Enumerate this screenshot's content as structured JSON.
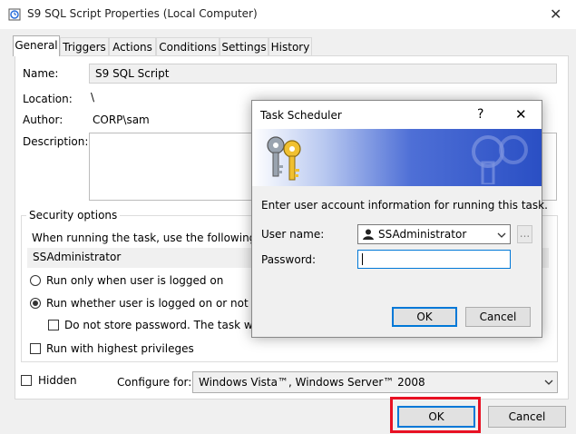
{
  "window": {
    "title": "S9 SQL Script Properties (Local Computer)",
    "close_glyph": "✕"
  },
  "tabs": [
    {
      "label": "General"
    },
    {
      "label": "Triggers"
    },
    {
      "label": "Actions"
    },
    {
      "label": "Conditions"
    },
    {
      "label": "Settings"
    },
    {
      "label": "History"
    }
  ],
  "general": {
    "name_label": "Name:",
    "name_value": "S9 SQL Script",
    "location_label": "Location:",
    "location_value": "\\",
    "author_label": "Author:",
    "author_value": "CORP\\sam",
    "description_label": "Description:",
    "description_value": ""
  },
  "security": {
    "group_label": "Security options",
    "run_as_text": "When running the task, use the following user",
    "user_value": "SSAdministrator",
    "opt_logged_on": "Run only when user is logged on",
    "opt_whether": "Run whether user is logged on or not",
    "opt_no_store": "Do not store password.  The task will on",
    "opt_highest": "Run with highest privileges",
    "selected": "whether"
  },
  "bottom": {
    "hidden_label": "Hidden",
    "configure_label": "Configure for:",
    "configure_value": "Windows Vista™, Windows Server™ 2008"
  },
  "footer": {
    "ok_label": "OK",
    "cancel_label": "Cancel"
  },
  "dialog": {
    "title": "Task Scheduler",
    "help_glyph": "?",
    "close_glyph": "✕",
    "prompt": "Enter user account information for running this task.",
    "username_label": "User name:",
    "username_value": "SSAdministrator",
    "browse_label": "...",
    "password_label": "Password:",
    "password_value": "",
    "ok_label": "OK",
    "cancel_label": "Cancel"
  },
  "colors": {
    "accent": "#0078d7",
    "highlight": "#e81123"
  }
}
